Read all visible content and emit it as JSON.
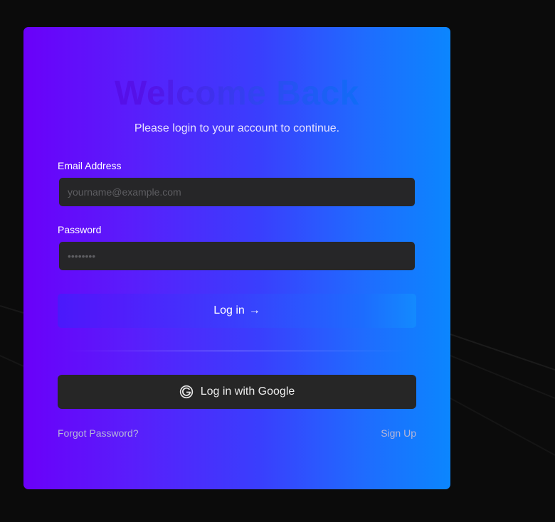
{
  "login": {
    "title": "Welcome Back",
    "subtitle": "Please login to your account to continue.",
    "email_label": "Email Address",
    "email_placeholder": "yourname@example.com",
    "email_value": "",
    "password_label": "Password",
    "password_placeholder": "••••••••",
    "password_value": "",
    "login_button": "Log in",
    "login_arrow": "→",
    "google_button": "Log in with Google",
    "forgot_password": "Forgot Password?",
    "sign_up": "Sign Up"
  },
  "icons": {
    "google": "google-g-icon",
    "arrow": "arrow-right-icon"
  },
  "colors": {
    "gradient_start": "#6a00f9",
    "gradient_end": "#0b86fe",
    "input_bg": "#262628",
    "page_bg": "#0b0b0b"
  }
}
